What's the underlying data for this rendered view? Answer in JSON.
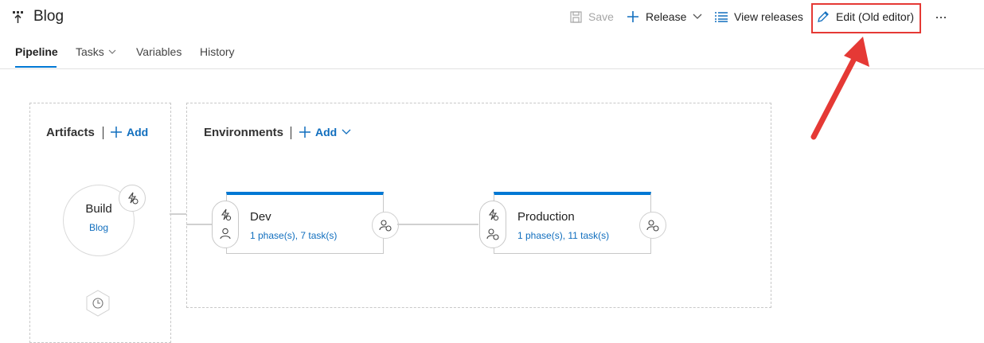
{
  "header": {
    "title": "Blog",
    "toolbar": {
      "save_label": "Save",
      "release_label": "Release",
      "view_releases_label": "View releases",
      "edit_label": "Edit (Old editor)",
      "more_label": "···"
    },
    "tabs": [
      {
        "label": "Pipeline",
        "active": true
      },
      {
        "label": "Tasks",
        "active": false
      },
      {
        "label": "Variables",
        "active": false
      },
      {
        "label": "History",
        "active": false
      }
    ]
  },
  "artifacts": {
    "title": "Artifacts",
    "add_label": "Add",
    "items": [
      {
        "name": "Build",
        "source": "Blog"
      }
    ]
  },
  "environments": {
    "title": "Environments",
    "add_label": "Add",
    "items": [
      {
        "name": "Dev",
        "summary": "1 phase(s), 7 task(s)"
      },
      {
        "name": "Production",
        "summary": "1 phase(s), 11 task(s)"
      }
    ]
  },
  "colors": {
    "accent": "#0078d4",
    "link": "#106ebe",
    "annotation": "#e53935"
  }
}
